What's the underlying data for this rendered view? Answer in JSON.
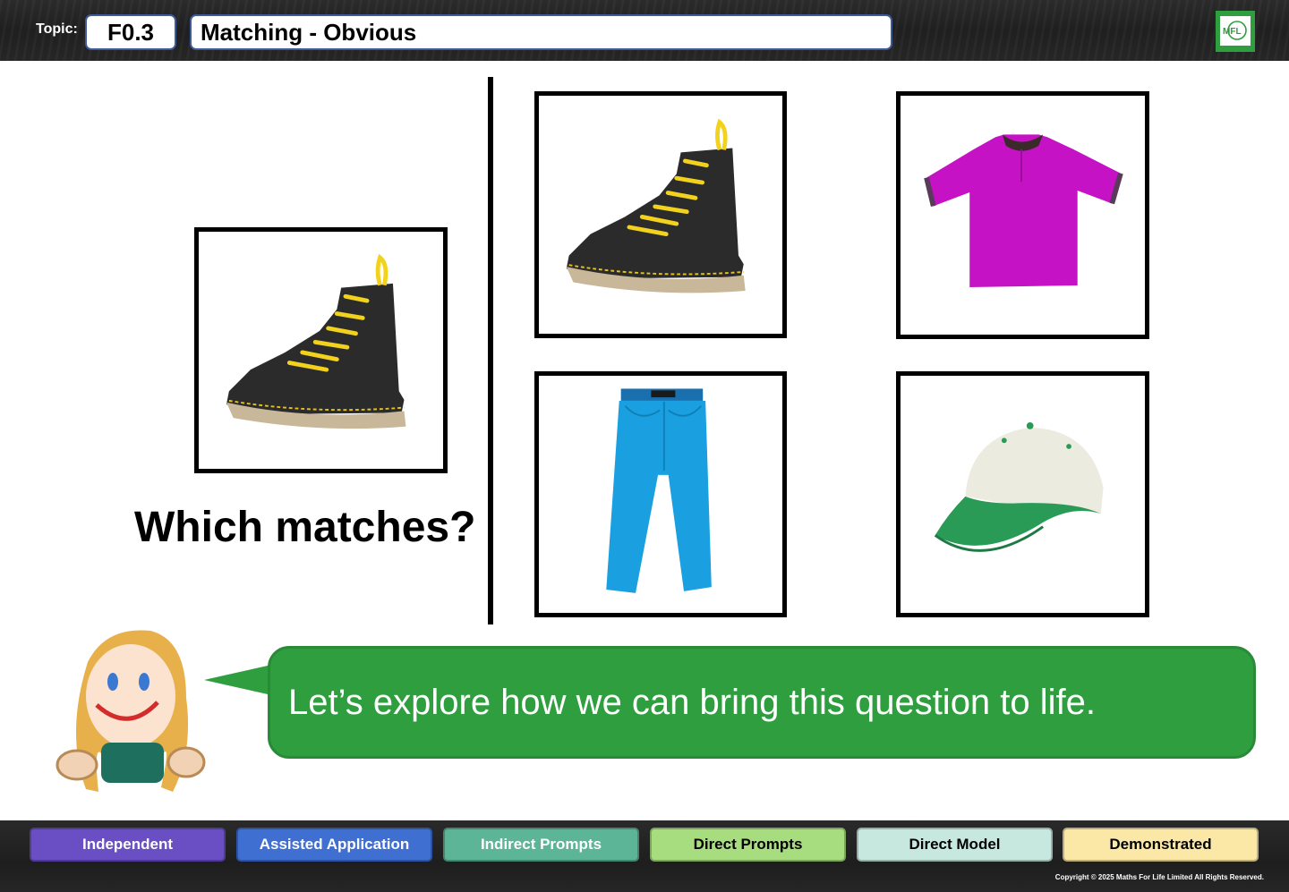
{
  "header": {
    "topic_label": "Topic:",
    "topic_code": "F0.3",
    "topic_title": "Matching - Obvious",
    "logo_text": "MFL"
  },
  "prompt": {
    "question": "Which matches?"
  },
  "cards": {
    "target": {
      "item": "boot-image"
    },
    "options": [
      {
        "item": "boot-image"
      },
      {
        "item": "polo-shirt-image"
      },
      {
        "item": "jeans-image"
      },
      {
        "item": "baseball-cap-image"
      }
    ]
  },
  "speech": {
    "text": "Let’s explore how we can bring this question to life."
  },
  "levels": [
    {
      "label": "Independent",
      "color": "#6a4fc4",
      "text_color": "#ffffff"
    },
    {
      "label": "Assisted Application",
      "color": "#3f6fd1",
      "text_color": "#ffffff"
    },
    {
      "label": "Indirect Prompts",
      "color": "#5bb596",
      "text_color": "#ffffff"
    },
    {
      "label": "Direct Prompts",
      "color": "#a7dc7f",
      "text_color": "#000000"
    },
    {
      "label": "Direct Model",
      "color": "#c7e8df",
      "text_color": "#000000"
    },
    {
      "label": "Demonstrated",
      "color": "#fbe8a6",
      "text_color": "#000000"
    }
  ],
  "footer": {
    "copyright": "Copyright © 2025 Maths For Life Limited All Rights Reserved."
  },
  "colors": {
    "bubble": "#2f9e3f",
    "header_border": "#3d5a99"
  }
}
